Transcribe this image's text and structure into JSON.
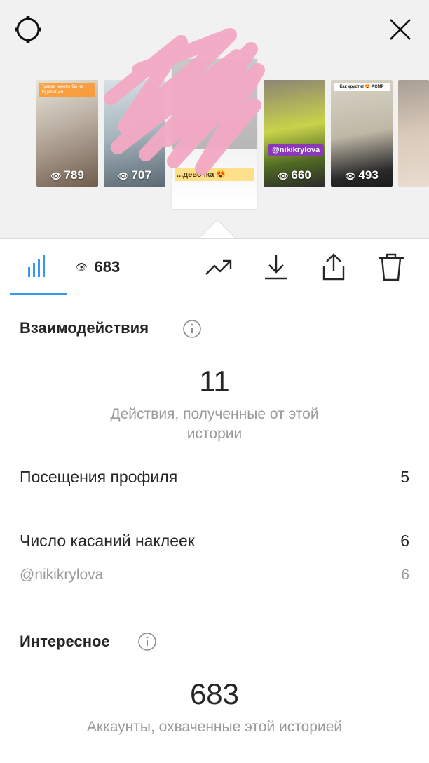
{
  "stories": [
    {
      "views": "789",
      "caption": "Правда почему бы не поделиться..."
    },
    {
      "views": "707",
      "caption": ""
    },
    {
      "views": "683",
      "caption": "...девочка 😍"
    },
    {
      "views": "660",
      "caption": "",
      "sticker": "@nikikrylova"
    },
    {
      "views": "493",
      "caption": "Как хрустит 😍 АСМР"
    }
  ],
  "toolbar": {
    "views_count": "683"
  },
  "interactions": {
    "title": "Взаимодействия",
    "total": "11",
    "caption": "Действия, полученные от этой истории",
    "rows": [
      {
        "label": "Посещения профиля",
        "value": "5"
      },
      {
        "label": "Число касаний наклеек",
        "value": "6"
      }
    ],
    "sub_rows": [
      {
        "label": "@nikikrylova",
        "value": "6"
      }
    ]
  },
  "discovery": {
    "title": "Интересное",
    "total": "683",
    "caption": "Аккаунты, охваченные этой историей"
  },
  "icons": {
    "settings": "gear-icon",
    "close": "close-icon",
    "insights": "bar-chart-icon",
    "eye": "eye-icon",
    "promote": "trending-up-icon",
    "download": "download-icon",
    "share": "share-icon",
    "delete": "trash-icon",
    "info": "info-icon"
  },
  "colors": {
    "accent": "#3897f0",
    "scribble": "#f4a9c4"
  }
}
